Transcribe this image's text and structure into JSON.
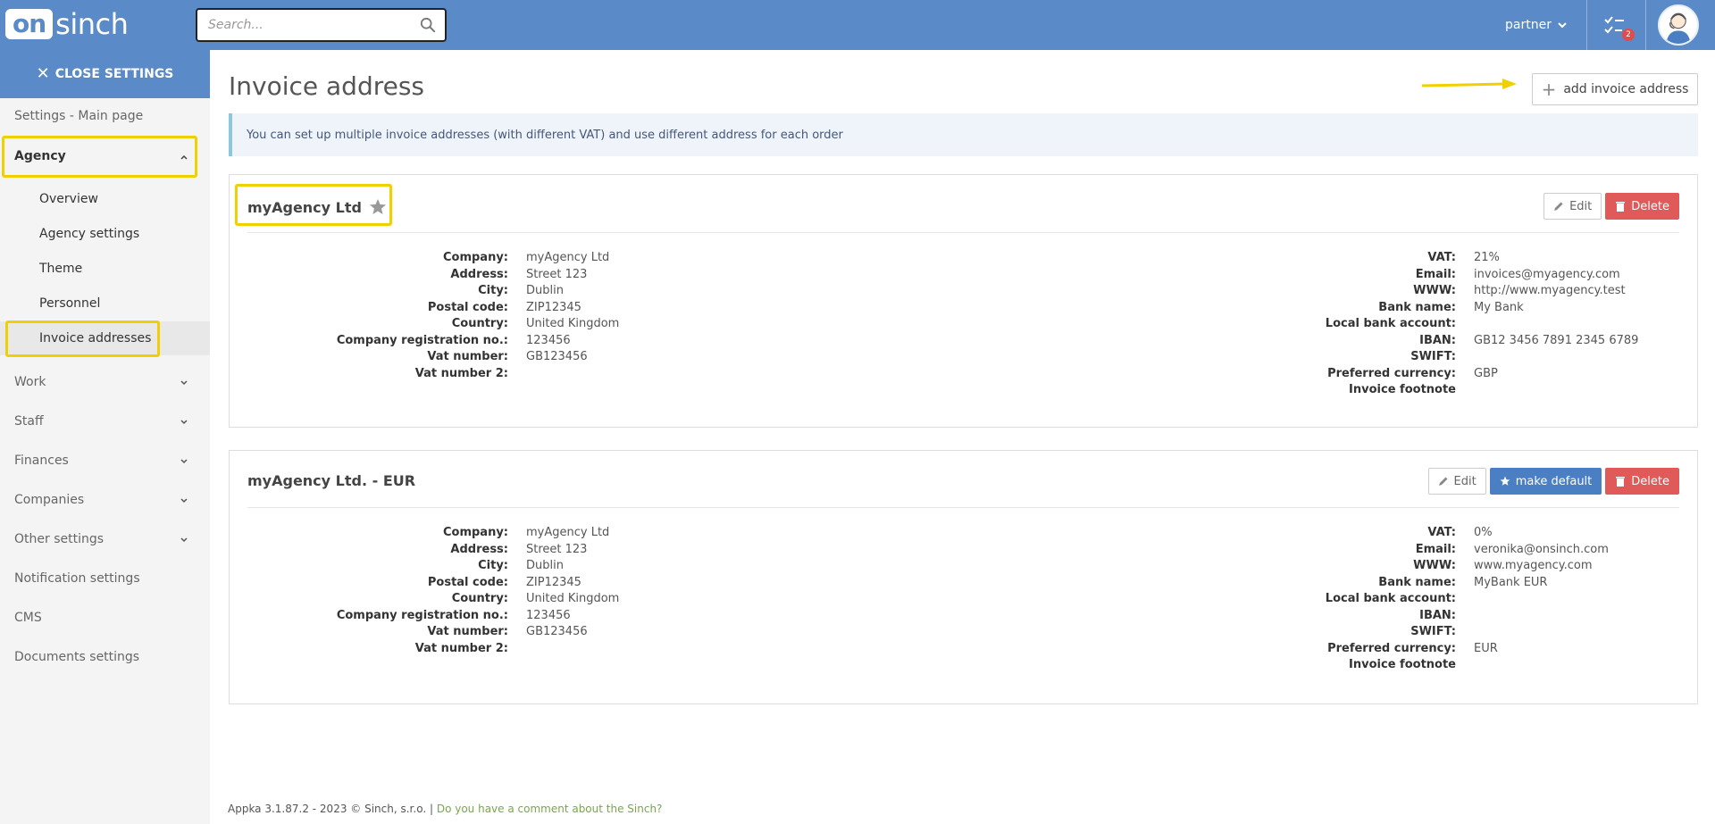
{
  "header": {
    "logo_on": "on",
    "logo_sinch": "sinch",
    "search_placeholder": "Search...",
    "user_label": "partner",
    "tasks_badge": "2"
  },
  "sidebar": {
    "close_label": "CLOSE SETTINGS",
    "main_page": "Settings - Main page",
    "agency": "Agency",
    "agency_items": [
      "Overview",
      "Agency settings",
      "Theme",
      "Personnel",
      "Invoice addresses"
    ],
    "sections": [
      "Work",
      "Staff",
      "Finances",
      "Companies",
      "Other settings"
    ],
    "plain_items": [
      "Notification settings",
      "CMS",
      "Documents settings"
    ]
  },
  "main": {
    "title": "Invoice address",
    "add_button": "add invoice address",
    "info": "You can set up multiple invoice addresses (with different VAT) and use different address for each order",
    "edit_label": "Edit",
    "delete_label": "Delete",
    "make_default_label": "make default",
    "left_labels": [
      "Company:",
      "Address:",
      "City:",
      "Postal code:",
      "Country:",
      "Company registration no.:",
      "Vat number:",
      "Vat number 2:"
    ],
    "right_labels": [
      "VAT:",
      "Email:",
      "WWW:",
      "Bank name:",
      "Local bank account:",
      "IBAN:",
      "SWIFT:",
      "Preferred currency:",
      "Invoice footnote"
    ],
    "cards": [
      {
        "name": "myAgency Ltd",
        "is_default": true,
        "left_values": [
          "myAgency Ltd",
          "Street 123",
          "Dublin",
          "ZIP12345",
          "United Kingdom",
          "123456",
          "GB123456",
          ""
        ],
        "right_values": [
          "21%",
          "invoices@myagency.com",
          "http://www.myagency.test",
          "My Bank",
          "",
          "GB12 3456 7891 2345 6789",
          "",
          "GBP",
          ""
        ]
      },
      {
        "name": "myAgency Ltd. - EUR",
        "is_default": false,
        "left_values": [
          "myAgency Ltd",
          "Street 123",
          "Dublin",
          "ZIP12345",
          "United Kingdom",
          "123456",
          "GB123456",
          ""
        ],
        "right_values": [
          "0%",
          "veronika@onsinch.com",
          "www.myagency.com",
          "MyBank EUR",
          "",
          "",
          "",
          "EUR",
          ""
        ]
      }
    ]
  },
  "footer": {
    "text": "Appka 3.1.87.2 - 2023 © Sinch, s.r.o. |",
    "link": "Do you have a comment about the Sinch?"
  }
}
